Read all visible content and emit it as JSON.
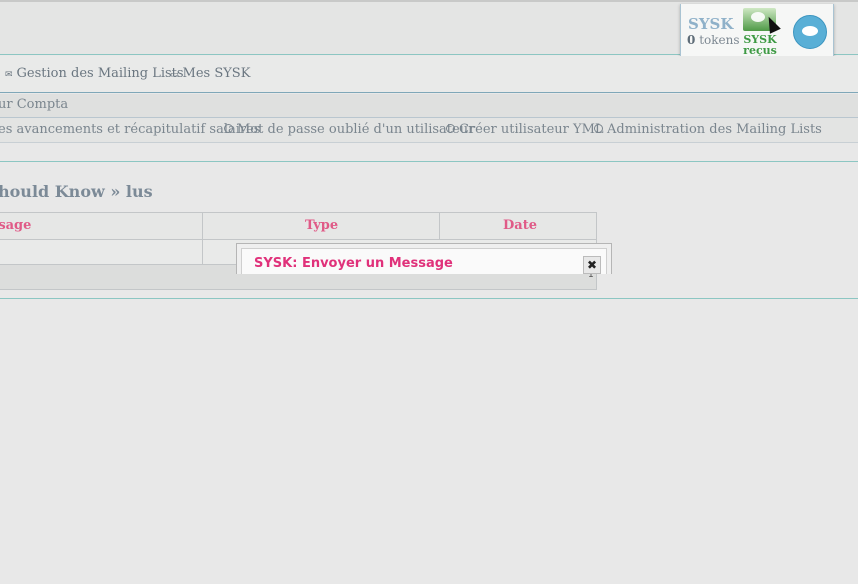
{
  "sysk_panel": {
    "title": "SYSK",
    "tokens_count": "0",
    "tokens_label": "tokens",
    "received_label_line1": "SYSK",
    "received_label_line2": "reçus"
  },
  "corner_text": "C",
  "menu": {
    "items": [
      {
        "label": "Gestion des Mailing Lists",
        "icon": "envelope-icon"
      },
      {
        "label": "Mes SYSK",
        "icon": "inbox-icon"
      }
    ]
  },
  "submenu1": {
    "label": "ur Compta"
  },
  "submenu2": {
    "items": [
      {
        "label": "es avancements et récapitulatif salaires"
      },
      {
        "label": "Mot de passe oublié d'un utilisateur"
      },
      {
        "label": "Créer utilisateur YML"
      },
      {
        "label": "Administration des Mailing Lists"
      }
    ]
  },
  "breadcrumb": "hould Know » lus",
  "table": {
    "headers": [
      "ssage",
      "Type",
      "Date"
    ],
    "page_number": "1"
  },
  "dialog": {
    "title": "SYSK: Envoyer un Message",
    "close_glyph": "✖"
  },
  "colors": {
    "accent": "#e05a87",
    "dialog_title": "#e0317a",
    "teal_line": "#8cc6c2",
    "sysk_green": "#3e9a44"
  }
}
